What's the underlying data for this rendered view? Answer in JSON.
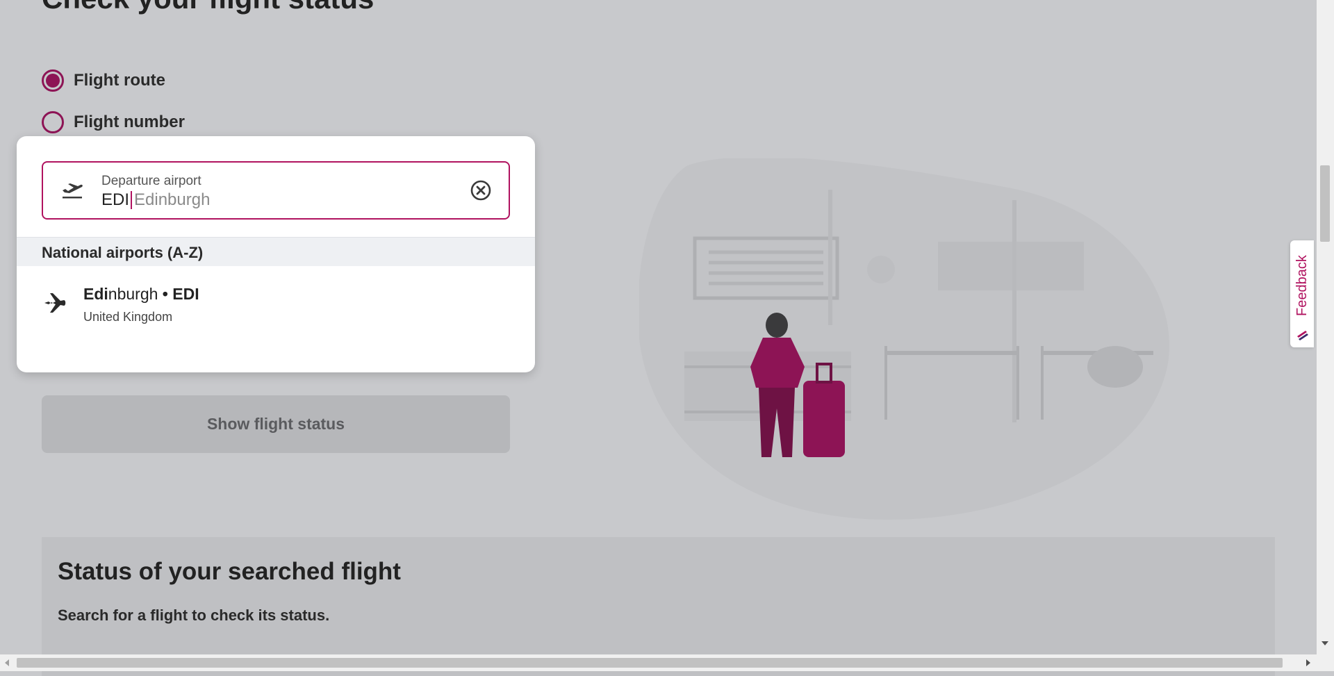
{
  "page": {
    "title": "Check your flight status"
  },
  "search_type": {
    "options": [
      {
        "label": "Flight route",
        "selected": true
      },
      {
        "label": "Flight number",
        "selected": false
      }
    ]
  },
  "departure": {
    "label": "Departure airport",
    "typed_value": "EDI",
    "suggestion": "Edinburgh"
  },
  "dropdown": {
    "section_title": "National airports (A-Z)",
    "results": [
      {
        "name_highlight": "Edi",
        "name_rest": "nburgh",
        "separator": " • ",
        "code": "EDI",
        "country": "United Kingdom"
      }
    ]
  },
  "actions": {
    "show_status_label": "Show flight status"
  },
  "status_section": {
    "title": "Status of your searched flight",
    "subtitle": "Search for a flight to check its status."
  },
  "feedback": {
    "label": "Feedback"
  },
  "colors": {
    "brand": "#8d1455",
    "brand_bright": "#b0125f",
    "overlay_bg": "#c8c9cc"
  },
  "icons": {
    "departure": "plane-departure-icon",
    "clear": "clear-circle-icon",
    "result": "airplane-icon"
  }
}
